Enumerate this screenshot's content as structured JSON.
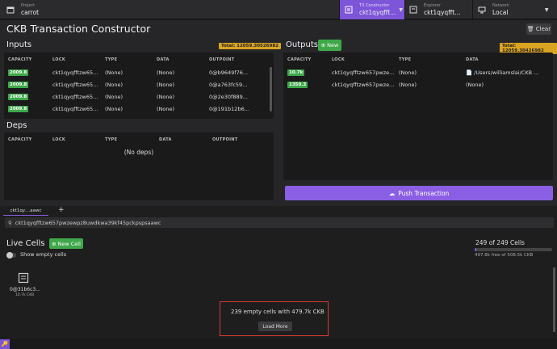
{
  "topbar": {
    "project_label": "Project",
    "project_value": "carrot",
    "tx_label": "TX Constructor",
    "tx_value": "ckt1qyqfft...",
    "explorer_label": "Explorer",
    "explorer_value": "ckt1qyqfft...",
    "network_label": "Network",
    "network_value": "Local",
    "accent": "#7d55d9"
  },
  "page_title": "CKB Transaction Constructor",
  "clear_label": "Clear",
  "inputs": {
    "title": "Inputs",
    "total": "Total: 12059.30526982",
    "columns": [
      "CAPACITY",
      "LOCK",
      "TYPE",
      "DATA",
      "OUTPOINT"
    ],
    "rows": [
      {
        "capacity": "2009.8",
        "lock": "ckt1qyqfftzw65...",
        "type": "(None)",
        "data": "(None)",
        "outpoint": "0@b9649f76..."
      },
      {
        "capacity": "2009.8",
        "lock": "ckt1qyqfftzw65...",
        "type": "(None)",
        "data": "(None)",
        "outpoint": "0@a763fc59..."
      },
      {
        "capacity": "2009.8",
        "lock": "ckt1qyqfftzw65...",
        "type": "(None)",
        "data": "(None)",
        "outpoint": "0@2e30f889..."
      },
      {
        "capacity": "2009.8",
        "lock": "ckt1qyqfftzw65...",
        "type": "(None)",
        "data": "(None)",
        "outpoint": "0@191b12b6..."
      }
    ]
  },
  "deps": {
    "title": "Deps",
    "columns": [
      "CAPACITY",
      "LOCK",
      "TYPE",
      "DATA",
      "OUTPOINT"
    ],
    "empty": "(No deps)"
  },
  "outputs": {
    "title": "Outputs",
    "new_label": "New",
    "total": "Total: 12059.30426982",
    "columns": [
      "CAPACITY",
      "LOCK",
      "TYPE",
      "DATA"
    ],
    "rows": [
      {
        "capacity": "10.7k",
        "lock": "ckt1qyqfftzw657pwze...",
        "type": "(None)",
        "data": "/Users/williamslai/CKB ..."
      },
      {
        "capacity": "1350.3",
        "lock": "ckt1qyqfftzw657pwze...",
        "type": "(None)",
        "data": "(None)"
      }
    ]
  },
  "push_label": "Push Transaction",
  "tab": {
    "label": "ckt1qy....aawc",
    "add": "+"
  },
  "address_bar": "ckt1qyqfftzw657pwzewpz8uwdkwa39kf45pckpspsaawc",
  "live": {
    "title": "Live Cells",
    "new_cell_label": "New Cell",
    "show_empty_label": "Show empty cells",
    "count": "249 of 249 Cells",
    "capacity_used_fraction": 0.02,
    "free_text": "497.8k free of 508.5k CKB",
    "cell": {
      "name": "0@31b6c3...",
      "capacity": "10.7k CKB"
    },
    "empty_text": "239 empty cells with 479.7k CKB",
    "load_more": "Load More"
  }
}
